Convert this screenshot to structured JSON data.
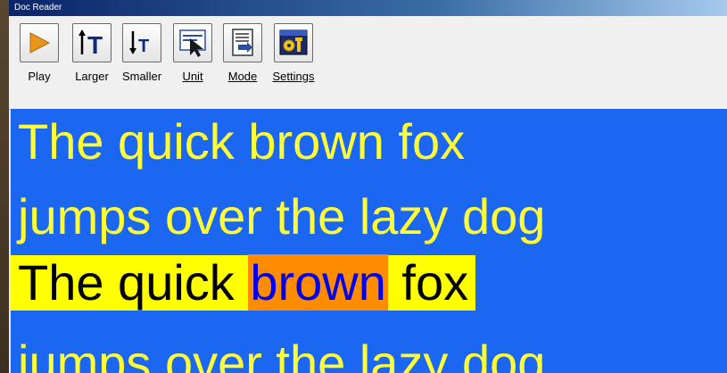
{
  "window": {
    "title": "Doc Reader"
  },
  "toolbar": {
    "play_label": "Play",
    "larger_label": "Larger",
    "smaller_label": "Smaller",
    "unit_label": "Unit",
    "mode_label": "Mode",
    "settings_label": "Settings"
  },
  "reader": {
    "line1": "The quick brown fox",
    "line2": "jumps over the lazy dog",
    "line3_before": "The quick ",
    "line3_word": "brown",
    "line3_after": " fox",
    "line4": "jumps over the lazy dog"
  },
  "colors": {
    "background": "#1b67f2",
    "text": "#ffff33",
    "line_highlight": "#ffff00",
    "word_highlight": "#ff8c00",
    "word_text": "#0000ee"
  }
}
